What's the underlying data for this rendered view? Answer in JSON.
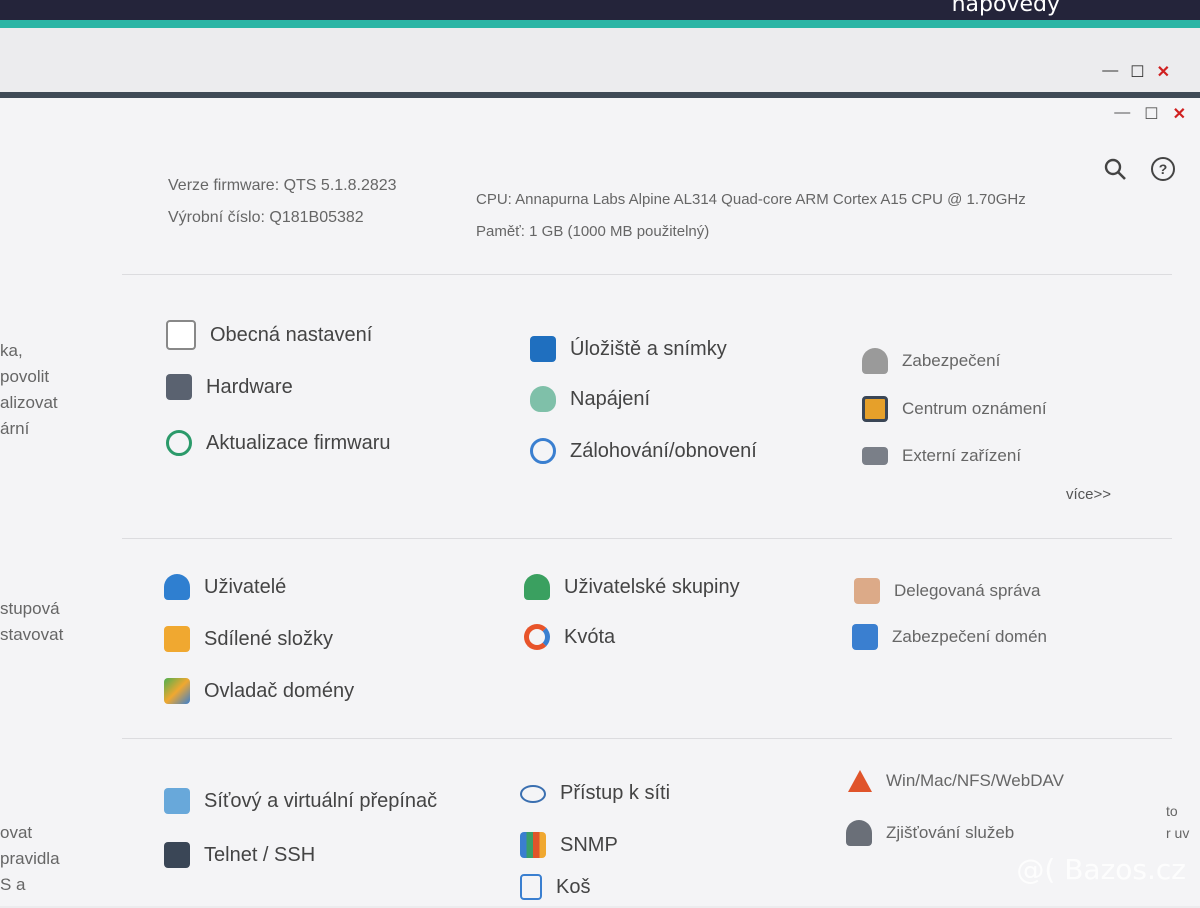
{
  "background": {
    "help_text": "nápovědy"
  },
  "window_controls": {
    "minimize": "—",
    "maximize": "☐",
    "close": "✕"
  },
  "sidebar_fragments": [
    "ka,",
    "povolit",
    "alizovat",
    "ární",
    "stupová",
    "stavovat",
    "ovat",
    "pravidla",
    "S a"
  ],
  "right_fragments": [
    "to",
    "r uv"
  ],
  "system_info": {
    "firmware": "Verze firmware:  QTS 5.1.8.2823",
    "serial": "Výrobní číslo:  Q181B05382",
    "cpu": "CPU:  Annapurna Labs Alpine AL314 Quad-core ARM Cortex A15 CPU @ 1.70GHz",
    "memory": "Paměť:  1 GB (1000 MB použitelný)"
  },
  "section_system": {
    "items": [
      {
        "label": "Obecná nastavení",
        "icon": "settings-icon",
        "color": "#888888"
      },
      {
        "label": "Úložiště a snímky",
        "icon": "storage-icon",
        "color": "#1f6fbf"
      },
      {
        "label": "Zabezpečení",
        "icon": "lock-icon",
        "color": "#9a9a9a"
      },
      {
        "label": "Hardware",
        "icon": "hardware-icon",
        "color": "#5a6270"
      },
      {
        "label": "Napájení",
        "icon": "bulb-icon",
        "color": "#7fc0a9"
      },
      {
        "label": "Centrum oznámení",
        "icon": "notification-icon",
        "color": "#e6a02a"
      },
      {
        "label": "Aktualizace firmwaru",
        "icon": "update-icon",
        "color": "#2b9a6a"
      },
      {
        "label": "Zálohování/obnovení",
        "icon": "backup-icon",
        "color": "#3a7fd0"
      },
      {
        "label": "Externí zařízení",
        "icon": "external-device-icon",
        "color": "#7a7f88"
      }
    ],
    "more": "více>>"
  },
  "section_privileges": {
    "items": [
      {
        "label": "Uživatelé",
        "icon": "user-icon",
        "color": "#2f7fd0"
      },
      {
        "label": "Uživatelské skupiny",
        "icon": "user-group-icon",
        "color": "#3aa060"
      },
      {
        "label": "Delegovaná správa",
        "icon": "delegate-icon",
        "color": "#d28a5a"
      },
      {
        "label": "Sdílené složky",
        "icon": "folder-icon",
        "color": "#f0a830"
      },
      {
        "label": "Kvóta",
        "icon": "quota-icon",
        "color": "#e8542a"
      },
      {
        "label": "Zabezpečení domén",
        "icon": "domain-security-icon",
        "color": "#3a7fd0"
      },
      {
        "label": "Ovladač domény",
        "icon": "domain-controller-icon",
        "color": "#4caf50"
      }
    ]
  },
  "section_network": {
    "items": [
      {
        "label": "Síťový a virtuální přepínač",
        "icon": "network-switch-icon",
        "color": "#3a8fd0"
      },
      {
        "label": "Přístup k síti",
        "icon": "network-access-icon",
        "color": "#3a6fb0"
      },
      {
        "label": "Win/Mac/NFS/WebDAV",
        "icon": "protocol-icon",
        "color": "#e0542a"
      },
      {
        "label": "Telnet / SSH",
        "icon": "terminal-icon",
        "color": "#3a4656"
      },
      {
        "label": "SNMP",
        "icon": "snmp-icon",
        "color": "#3a9f6a"
      },
      {
        "label": "Zjišťování služeb",
        "icon": "service-discovery-icon",
        "color": "#6a6f78"
      },
      {
        "label": "Koš",
        "icon": "trash-icon",
        "color": "#3a7fd0"
      }
    ]
  },
  "watermark": "@( Bazos.cz"
}
